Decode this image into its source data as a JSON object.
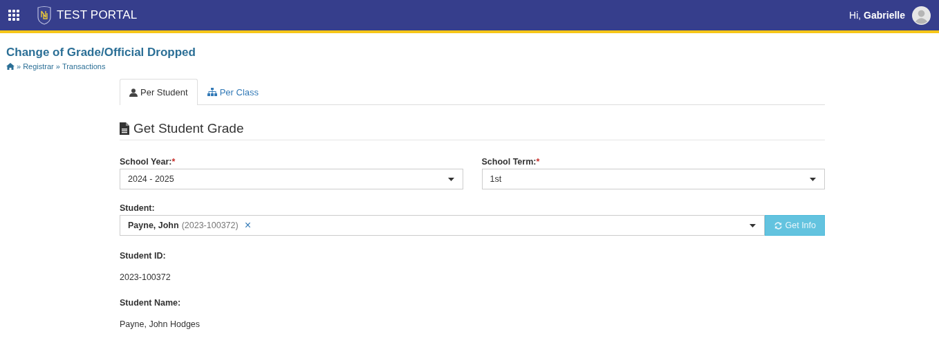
{
  "header": {
    "brand": "TEST PORTAL",
    "greeting": "Hi, ",
    "user": "Gabrielle"
  },
  "page": {
    "title": "Change of Grade/Official Dropped",
    "breadcrumbs": [
      "Registrar",
      "Transactions"
    ],
    "separator": "»"
  },
  "tabs": [
    {
      "label": "Per Student",
      "selected": true,
      "kind": "person"
    },
    {
      "label": "Per Class",
      "selected": false,
      "kind": "group"
    }
  ],
  "section": {
    "title": "Get Student Grade"
  },
  "fields": [
    {
      "label": "School Year:",
      "required_mark": "*",
      "value": "2024 - 2025"
    },
    {
      "label": "School Term:",
      "required_mark": "*",
      "value": "1st"
    }
  ],
  "student": {
    "label": "Student:",
    "name": "Payne, John",
    "id": "(2023-100372)",
    "clear": "×",
    "button": "Get Info",
    "disabled": true
  },
  "details": [
    {
      "label": "Student ID:",
      "value": "2023-100372"
    },
    {
      "label": "Student Name:",
      "value": "Payne, John Hodges"
    }
  ]
}
